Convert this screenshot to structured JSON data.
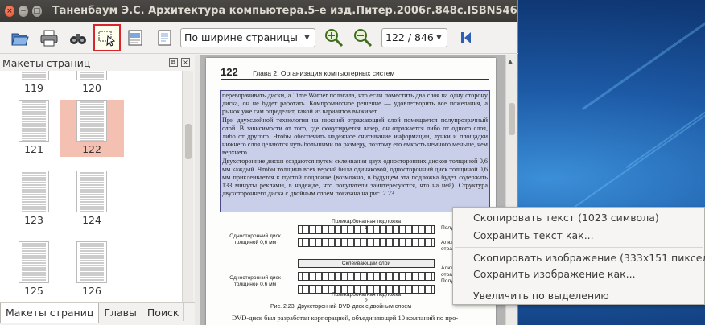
{
  "window": {
    "title": "Таненбаум Э.С. Архитектура компьютера.5-е изд.Питер.2006г.848с.ISBN5469012743.DjVu",
    "close_glyph": "×",
    "min_glyph": "−",
    "max_glyph": "□"
  },
  "toolbar": {
    "zoom_mode": "По ширине страницы",
    "page_indicator": "122 / 846",
    "icons": [
      "open-icon",
      "print-icon",
      "find-icon",
      "select-region-icon",
      "export-icon",
      "page-layout-icon",
      "zoom-in-icon",
      "zoom-out-icon",
      "first-page-icon"
    ]
  },
  "sidebar": {
    "title": "Макеты страниц",
    "float_glyph": "⧉",
    "close_glyph": "×",
    "thumbnails": [
      {
        "label": "119"
      },
      {
        "label": "120"
      },
      {
        "label": "121"
      },
      {
        "label": "122",
        "active": true
      },
      {
        "label": "123"
      },
      {
        "label": "124"
      },
      {
        "label": "125"
      },
      {
        "label": "126"
      }
    ],
    "tabs": [
      "Макеты страниц",
      "Главы",
      "Поиск"
    ]
  },
  "page": {
    "number": "122",
    "header": "Глава 2. Организация компьютерных систем",
    "body": "переворачивать диски, а Time Warner полагала, что если поместить два слоя на одну сторону диска, он не будет работать. Компромиссное решение — удовлетворить все пожелания, а рынок уже сам определит, какой из вариантов выживет.\n    При двухслойной технологии на нижний отражающий слой помещается полупрозрачный слой. В зависимости от того, где фокусируется лазер, он отражается либо от одного слоя, либо от другого. Чтобы обеспечить надежное считывание информации, лунки и площадки нижнего слоя делаются чуть большими по размеру, поэтому его емкость немного меньше, чем верхнего.\n    Двухсторонние диски создаются путем склеивания двух односторонних дисков толщиной 0,6 мм каждый. Чтобы толщина всех версий была одинаковой, односторонний диск толщиной 0,6 мм приклеивается к пустой подложке (возможно, в будущем эта подложка будет содержать 133 минуты рекламы, в надежде, что покупатели заинтересуются, что на ней). Структура двухстороннего диска с двойным слоем показана на рис. 2.23.",
    "figure": {
      "top_substrate": "Поликарбонатная подложка 1",
      "bottom_substrate": "Поликарбонатная подложка 2",
      "glue": "Склеивающий слой",
      "side_top": "Односторонний диск толщиной 0,6 мм",
      "side_bottom": "Односторонний диск толщиной 0,6 мм",
      "right_1": "Полуп",
      "right_2": "Алюмин отраж",
      "right_3": "Алюми отраж",
      "right_4": "Полуп"
    },
    "caption": "Рис. 2.23. Двухсторонний DVD-диск с двойным слоем",
    "footer": "DVD-диск был разработан корпорацией, объединяющей 10 компаний по про-"
  },
  "context_menu": {
    "items": [
      "Скопировать текст (1023 символа)",
      "Сохранить текст как...",
      "Скопировать изображение (333x151 пикселов)",
      "Сохранить изображение как...",
      "Увеличить по выделению"
    ]
  },
  "colors": {
    "selection_fill": "#8c96d2",
    "active_thumb": "#f3c0b1",
    "selected_tool_border": "#d9262e"
  }
}
